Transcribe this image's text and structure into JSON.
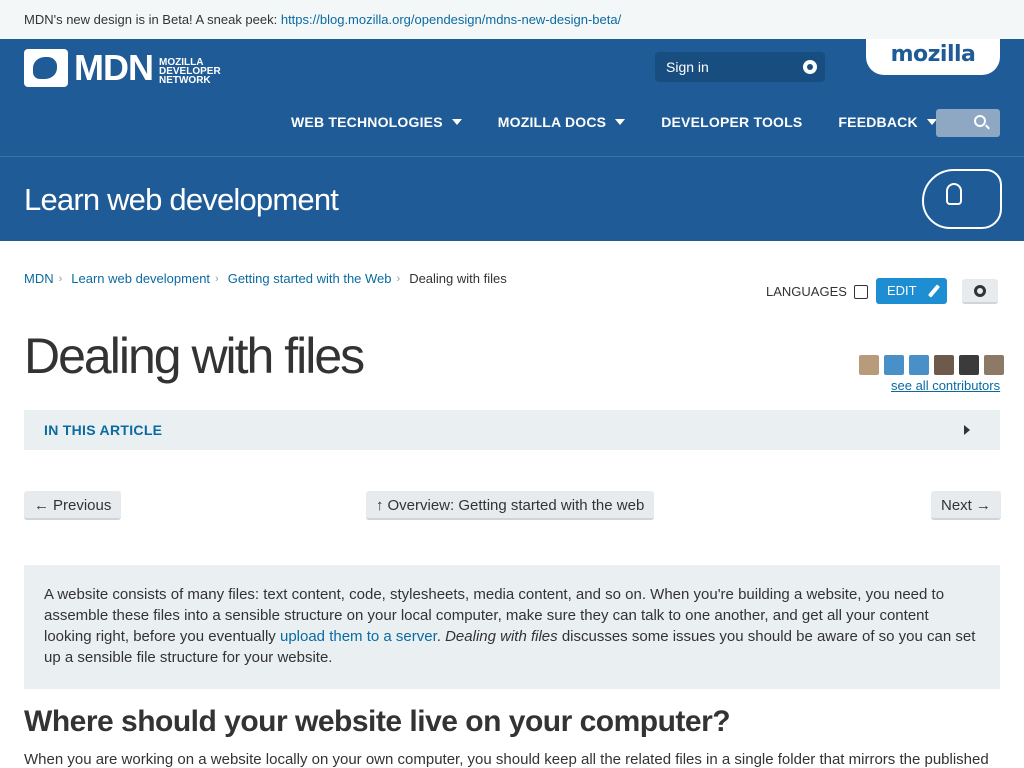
{
  "beta_banner": {
    "text": "MDN's new design is in Beta! A sneak peek: ",
    "link": "https://blog.mozilla.org/opendesign/mdns-new-design-beta/"
  },
  "header": {
    "logo_text": "MDN",
    "logo_sub": "MOZILLA DEVELOPER NETWORK",
    "sign_in": "Sign in",
    "mozilla": "mozilla",
    "nav": [
      {
        "label": "WEB TECHNOLOGIES",
        "has_caret": true
      },
      {
        "label": "MOZILLA DOCS",
        "has_caret": true
      },
      {
        "label": "DEVELOPER TOOLS",
        "has_caret": false
      },
      {
        "label": "FEEDBACK",
        "has_caret": true
      }
    ]
  },
  "title_band": {
    "title": "Learn web development"
  },
  "breadcrumb": {
    "items": [
      "MDN",
      "Learn web development",
      "Getting started with the Web"
    ],
    "current": "Dealing with files"
  },
  "toolbar": {
    "languages": "LANGUAGES",
    "edit": "EDIT"
  },
  "page": {
    "title": "Dealing with files",
    "see_all_contributors": "see all contributors",
    "toc_label": "IN THIS ARTICLE",
    "prev": "Previous",
    "overview": "Overview: Getting started with the web",
    "next": "Next",
    "intro_part1": "A website consists of many files: text content, code, stylesheets, media content, and so on. When you're building a website, you need to assemble these files into a sensible structure on your local computer, make sure they can talk to one another, and get all your content looking right, before you eventually ",
    "intro_link": "upload them to a server",
    "intro_part2": ". ",
    "intro_em": "Dealing with files",
    "intro_part3": " discusses some issues you should be aware of so you can set up a sensible file structure for your website.",
    "section_heading": "Where should your website live on your computer?",
    "section_text": "When you are working on a website locally on your own computer, you should keep all the related files in a single folder that mirrors the published"
  },
  "colors": {
    "header_blue": "#1f5b96",
    "link_blue": "#0a6ba1",
    "edit_blue": "#1d8ed1",
    "panel_gray": "#eaeff2"
  },
  "contributors": [
    "avatar-1",
    "avatar-2",
    "avatar-3",
    "avatar-4",
    "avatar-5",
    "avatar-6"
  ]
}
